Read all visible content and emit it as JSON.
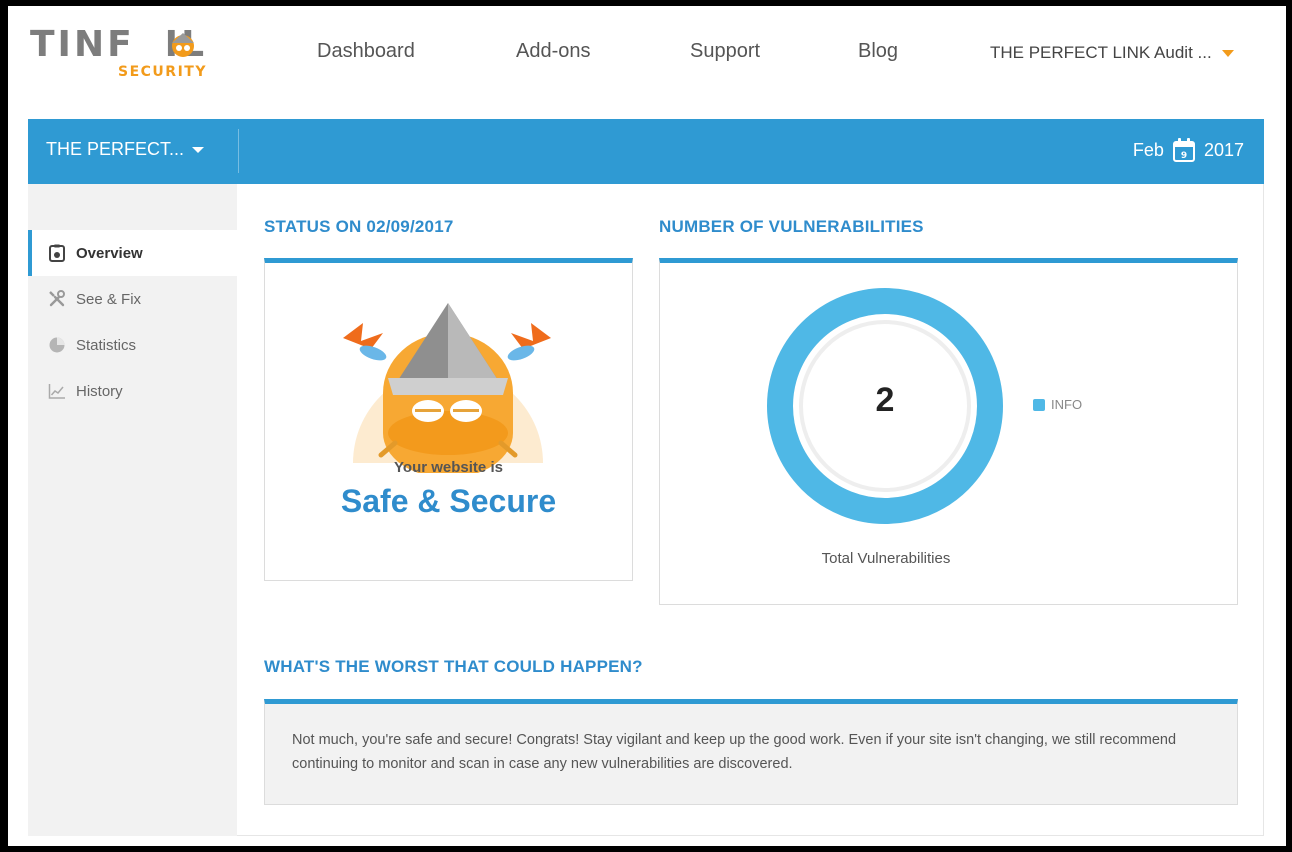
{
  "brand": {
    "logo_word": "TINF",
    "logo_word_end": "IL",
    "logo_sub": "SECURITY",
    "accent_orange": "#f29b1b",
    "accent_blue": "#2f9ad3"
  },
  "topnav": {
    "items": [
      {
        "label": "Dashboard"
      },
      {
        "label": "Add-ons"
      },
      {
        "label": "Support"
      },
      {
        "label": "Blog"
      }
    ],
    "account_label": "THE PERFECT LINK Audit ...",
    "account_icon": "chevron-down-icon"
  },
  "bluebar": {
    "site_label": "THE PERFECT...",
    "month": "Feb",
    "day": "9",
    "year": "2017"
  },
  "sidebar": {
    "items": [
      {
        "label": "Overview",
        "icon": "clipboard-icon",
        "active": true
      },
      {
        "label": "See & Fix",
        "icon": "tools-icon",
        "active": false
      },
      {
        "label": "Statistics",
        "icon": "pie-chart-icon",
        "active": false
      },
      {
        "label": "History",
        "icon": "line-chart-icon",
        "active": false
      }
    ]
  },
  "status": {
    "title": "STATUS ON 02/09/2017",
    "line1": "Your website is",
    "line2": "Safe & Secure"
  },
  "vulnerabilities": {
    "title": "NUMBER OF VULNERABILITIES",
    "count": "2",
    "legend_label": "INFO",
    "legend_color": "#4fb8e6",
    "info_share": 1.0,
    "footer": "Total Vulnerabilities"
  },
  "worst": {
    "title": "WHAT'S THE WORST THAT COULD HAPPEN?",
    "body": "Not much, you're safe and secure! Congrats! Stay vigilant and keep up the good work. Even if your site isn't changing, we still recommend continuing to monitor and scan in case any new vulnerabilities are discovered."
  }
}
